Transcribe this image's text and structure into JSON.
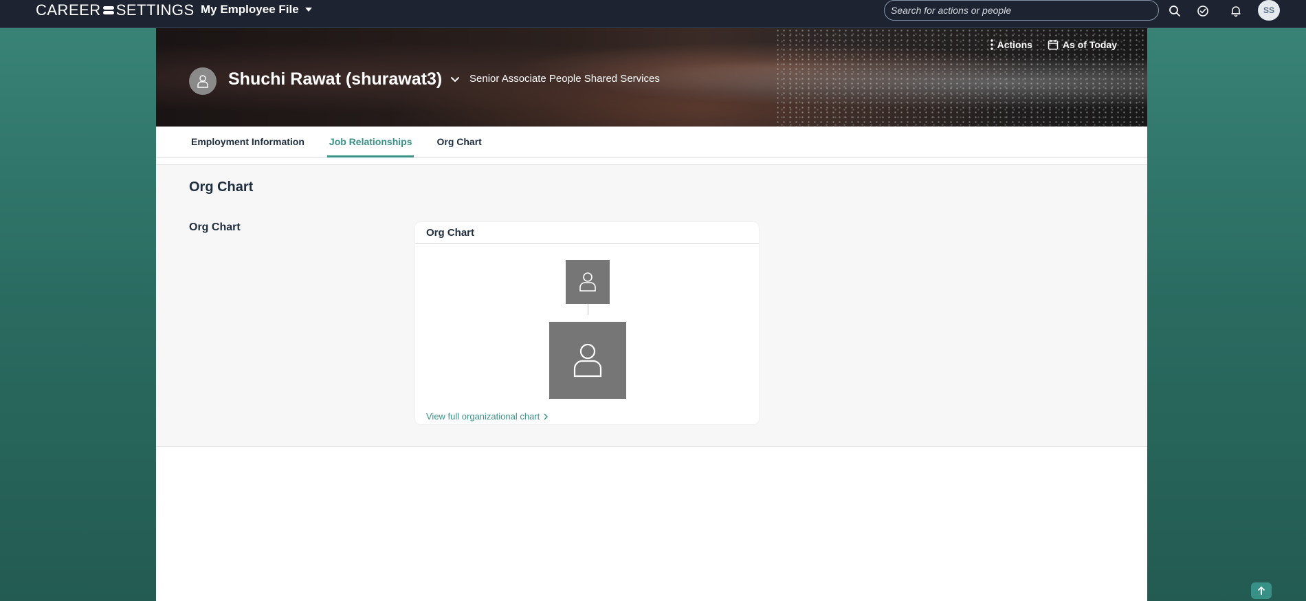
{
  "shell": {
    "logo_left": "CAREER",
    "logo_right": "SETTINGS",
    "app_menu_label": "My Employee File",
    "search_placeholder": "Search for actions or people",
    "user_initials": "SS",
    "icons": [
      "search-icon",
      "check-circle-icon",
      "bell-icon"
    ]
  },
  "header": {
    "actions_label": "Actions",
    "date_label": "As of Today",
    "name": "Shuchi Rawat (shurawat3)",
    "title": "Senior Associate People Shared Services"
  },
  "tabs": [
    {
      "label": "Employment Information",
      "active": false
    },
    {
      "label": "Job Relationships",
      "active": true
    },
    {
      "label": "Org Chart",
      "active": false
    }
  ],
  "section": {
    "title": "Org Chart",
    "sub_label": "Org Chart",
    "card_title": "Org Chart",
    "view_link": "View full organizational chart"
  },
  "colors": {
    "accent": "#389187",
    "shell_bg": "#1d2330",
    "node_bg": "#767676"
  }
}
